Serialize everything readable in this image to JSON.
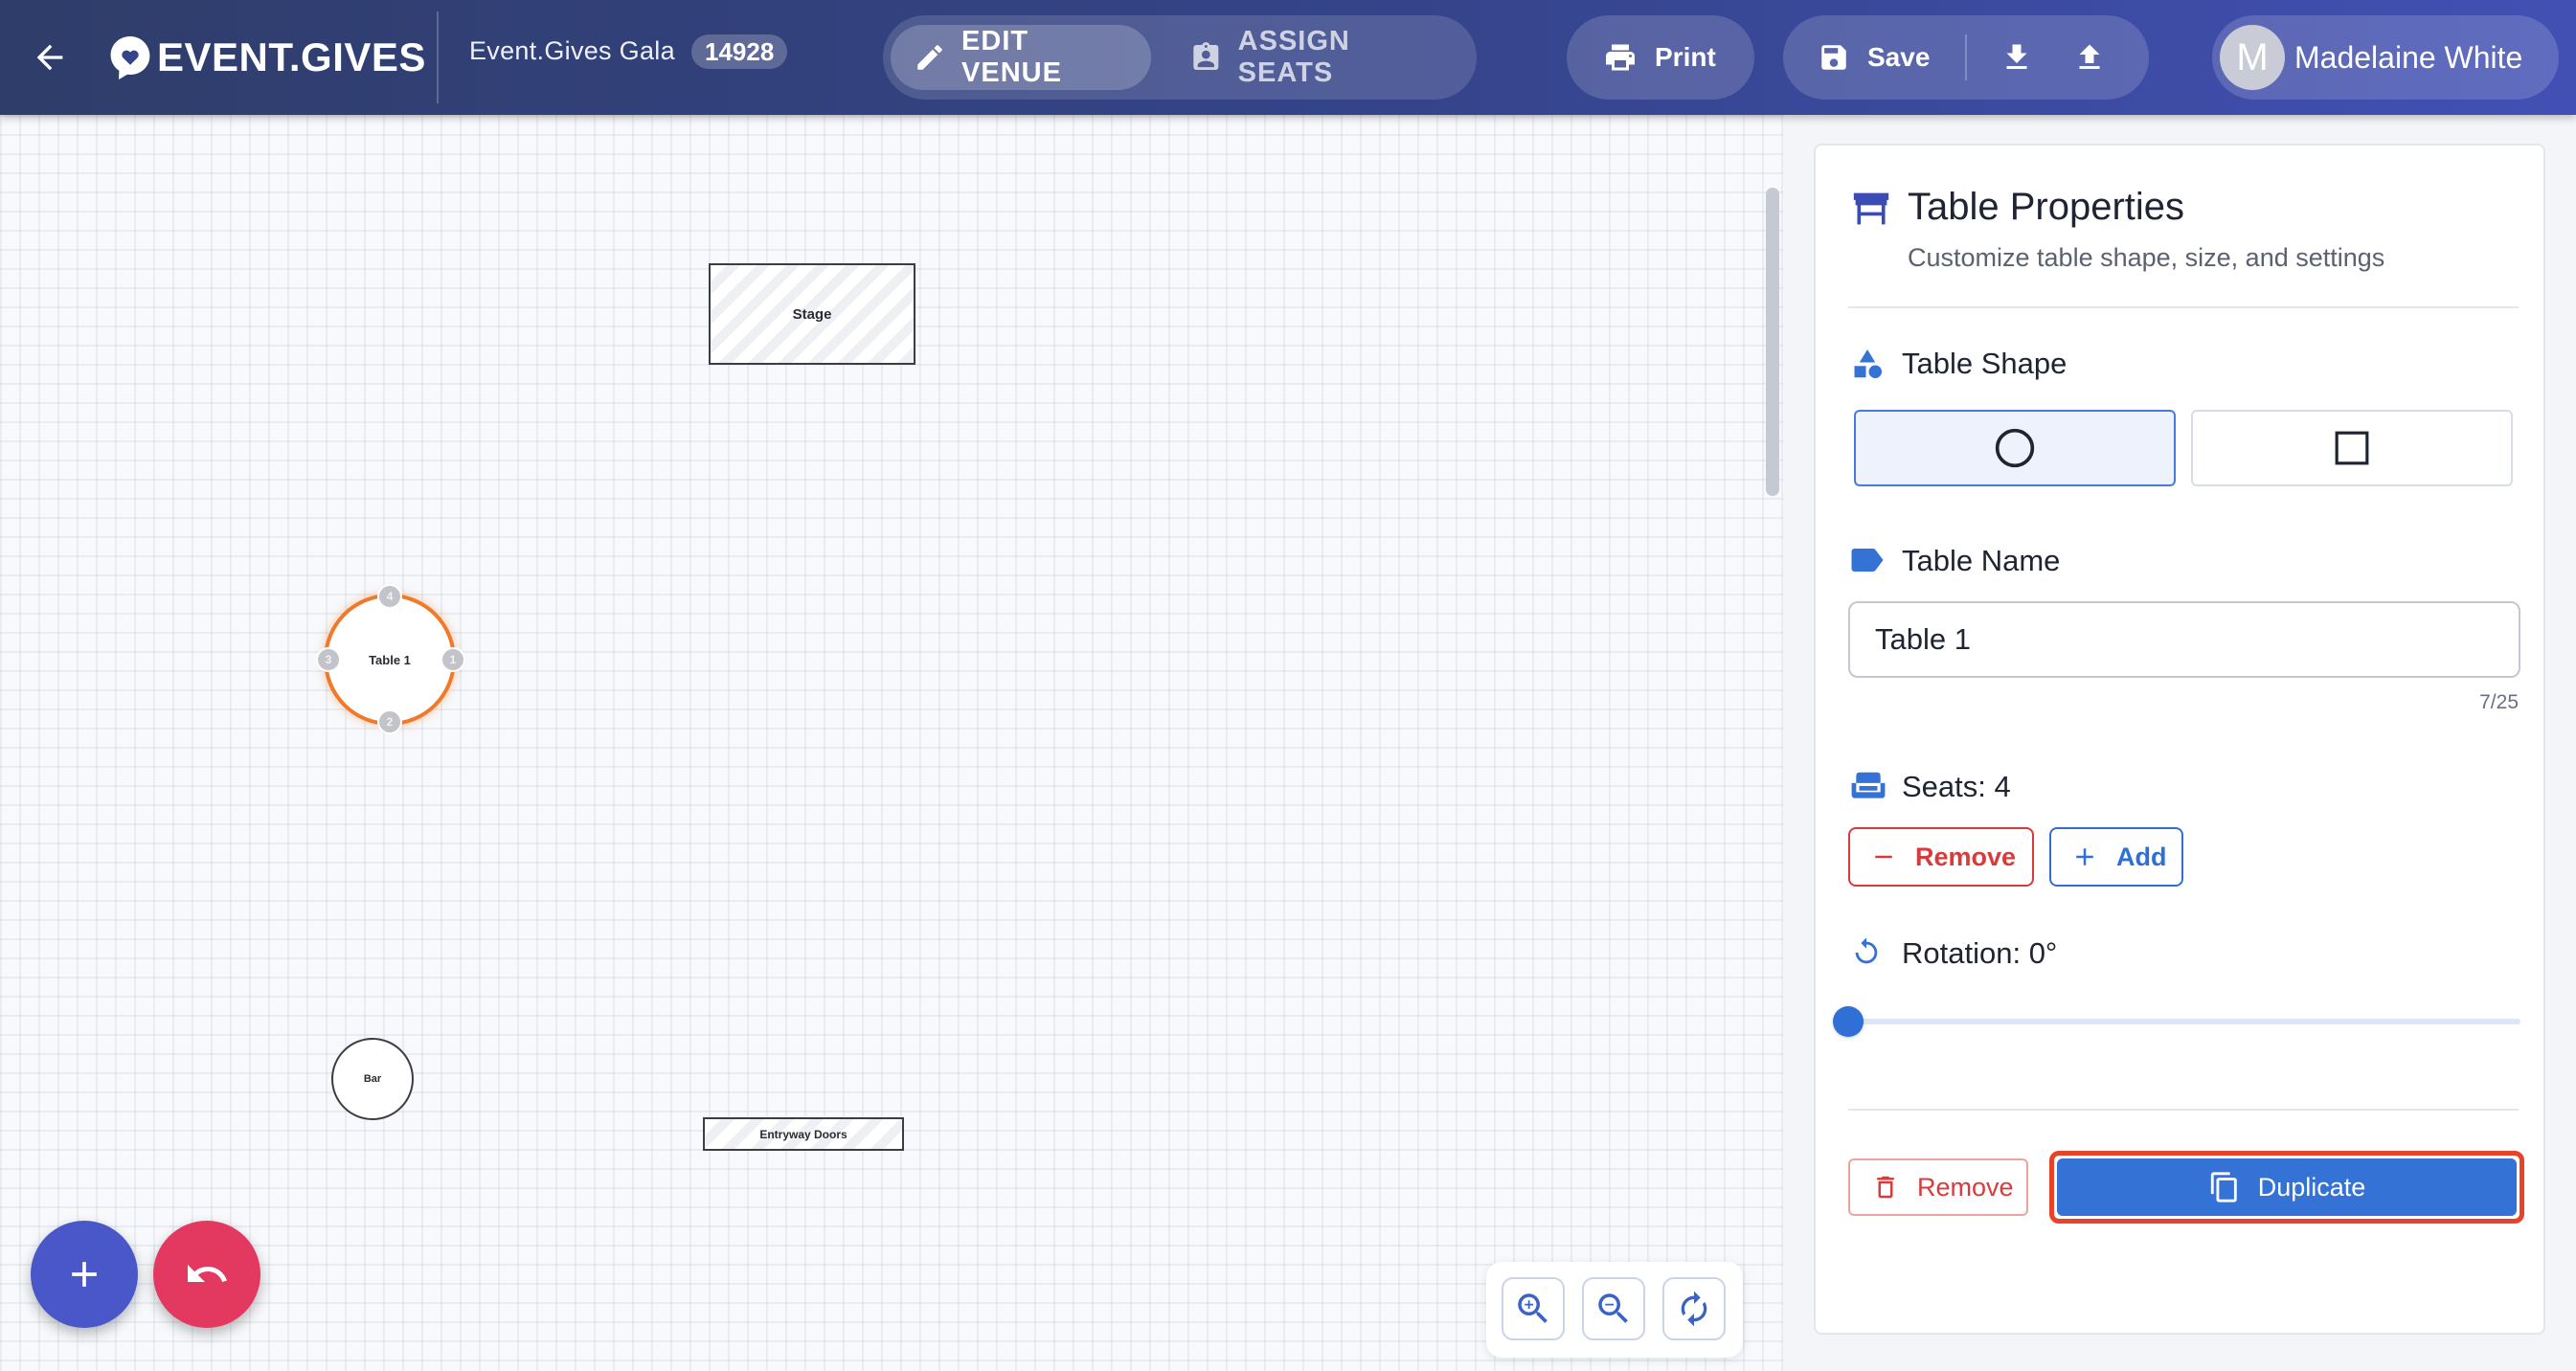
{
  "header": {
    "brand": "EVENT.GIVES",
    "event_name": "Event.Gives Gala",
    "event_id": "14928",
    "modes": {
      "edit": "EDIT VENUE",
      "assign": "ASSIGN SEATS"
    },
    "print_label": "Print",
    "save_label": "Save",
    "user": {
      "initial": "M",
      "name": "Madelaine White"
    }
  },
  "canvas": {
    "stage_label": "Stage",
    "table_label": "Table 1",
    "seats": [
      "4",
      "1",
      "2",
      "3"
    ],
    "bar_label": "Bar",
    "entry_label": "Entryway Doors"
  },
  "panel": {
    "title": "Table Properties",
    "subtitle": "Customize table shape, size, and settings",
    "shape_label": "Table Shape",
    "name_label": "Table Name",
    "name_value": "Table 1",
    "name_counter": "7/25",
    "seats_label": "Seats: 4",
    "seats_remove": "Remove",
    "seats_add": "Add",
    "rotation_label": "Rotation: 0°",
    "rotation_value": 0,
    "remove_label": "Remove",
    "duplicate_label": "Duplicate"
  },
  "colors": {
    "accent": "#3572d6",
    "selected_outline": "#f07a2a",
    "danger": "#d83b3b",
    "fab_add": "#4a57c9",
    "fab_undo": "#e33960"
  }
}
